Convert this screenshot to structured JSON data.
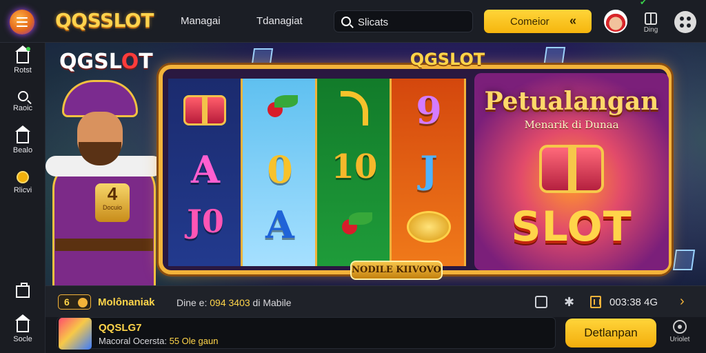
{
  "header": {
    "brand": "QQSSLOT",
    "nav": [
      "Managai",
      "Tdanagiat"
    ],
    "search": {
      "placeholder": "Slicats"
    },
    "cta_label": "Comeior",
    "cta_arrow": "«",
    "gift_label": "Ding"
  },
  "sidebar": {
    "items": [
      {
        "label": "Rotst",
        "icon": "home-icon"
      },
      {
        "label": "Raoic",
        "icon": "search-icon"
      },
      {
        "label": "Bealo",
        "icon": "bag-icon"
      },
      {
        "label": "Rlicvi",
        "icon": "coin-icon"
      },
      {
        "label": "Socle",
        "icon": "home-icon"
      }
    ]
  },
  "hero": {
    "brand": "QGSL",
    "brand_o": "O",
    "brand_end": "T",
    "frame_title": "QGSLOT",
    "character_badge_num": "4",
    "character_badge_text": "Docuio",
    "reel_symbols": {
      "reel1": [
        "A",
        "J0"
      ],
      "reel2": [
        "0",
        "A"
      ],
      "reel3": [
        "10"
      ],
      "reel4": [
        "9",
        "J"
      ]
    },
    "promo_title": "Petualangan",
    "promo_sub": "Menarik di Dunaa",
    "promo_slot": "SLOT",
    "ribbon": "NODILE KIIVOVO"
  },
  "info_bar": {
    "level": "6",
    "name": "Molônaniak",
    "detail_prefix": "Dine e: ",
    "detail_value": "094 3403",
    "detail_suffix": " di Mabile",
    "time": "003:38 4G",
    "chevron": "›"
  },
  "game_bar": {
    "title": "QQSLG7",
    "sub_prefix": "Macoral Ocersta: ",
    "sub_value": "55 Ole gaun",
    "play_label": "Detlanpan",
    "support_label": "Uriolet"
  },
  "colors": {
    "accent": "#ffd54a",
    "bg": "#14161c",
    "cta": "#f5b50d"
  }
}
